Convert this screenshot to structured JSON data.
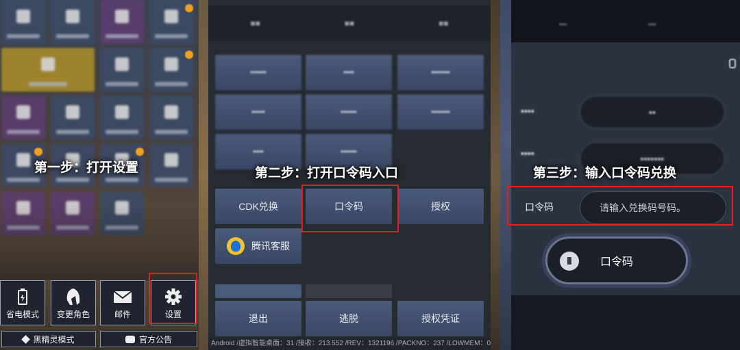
{
  "steps": {
    "step1": "第一步：打开设置",
    "step2": "第二步：打开口令码入口",
    "step3": "第三步：输入口令码兑换"
  },
  "panel1": {
    "bottom_buttons": [
      {
        "label": "省电模式",
        "icon": "battery-icon"
      },
      {
        "label": "变更角色",
        "icon": "helmet-icon"
      },
      {
        "label": "邮件",
        "icon": "mail-icon"
      },
      {
        "label": "设置",
        "icon": "gear-icon"
      }
    ],
    "wide_buttons": [
      {
        "label": "黑精灵模式",
        "icon": "diamond-icon"
      },
      {
        "label": "官方公告",
        "icon": "chat-icon"
      }
    ]
  },
  "panel2": {
    "row_cdk": "CDK兑换",
    "row_code": "口令码",
    "row_auth": "授权",
    "service": "腾讯客服",
    "exit": "退出",
    "escape": "逃脱",
    "auth_cert": "授权凭证",
    "status": "Android /虚拟智能桌面：31 /接收：213.552 /REV：1321196 /PACKNO：237 /LOWMEM：0"
  },
  "panel3": {
    "code_label": "口令码",
    "code_placeholder": "请输入兑换码号码。",
    "redeem_button": "口令码"
  },
  "colors": {
    "highlight_red": "#e02020",
    "button_blue": "#3a4764"
  }
}
